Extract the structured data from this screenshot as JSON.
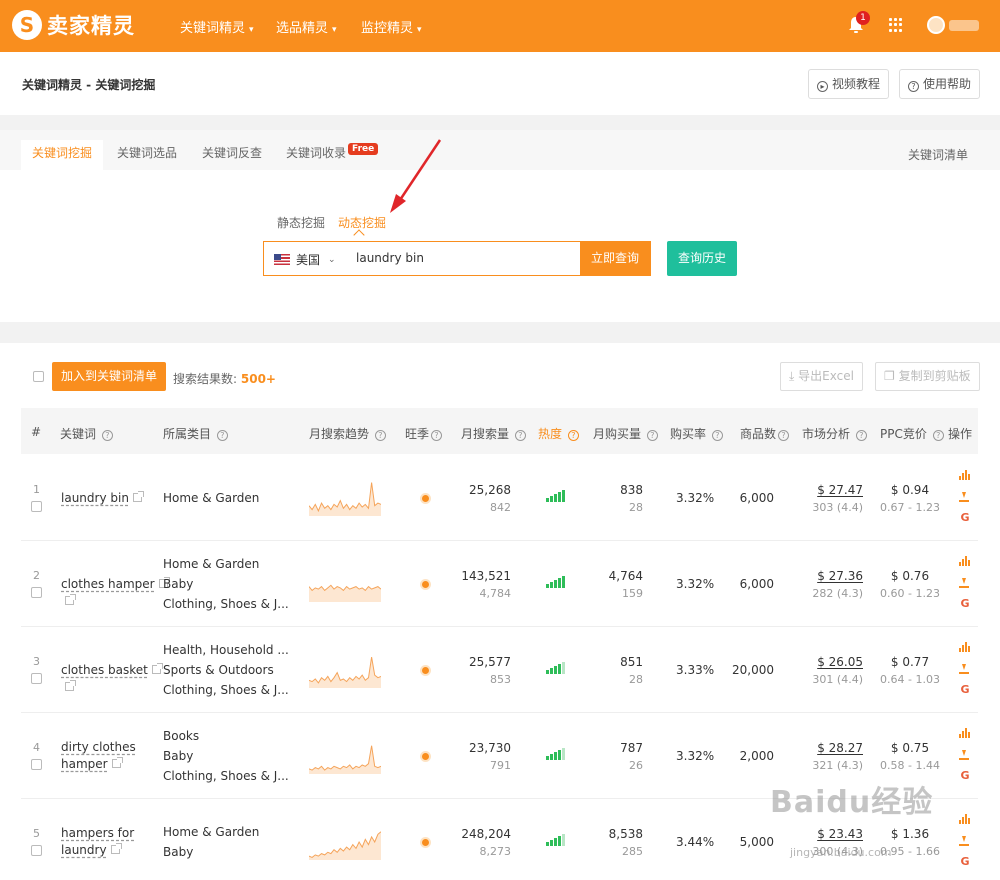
{
  "topbar": {
    "logo_glyph": "S",
    "logo_text": "卖家精灵",
    "nav": [
      {
        "label": "关键词精灵"
      },
      {
        "label": "选品精灵"
      },
      {
        "label": "监控精灵"
      }
    ],
    "notification_count": "1",
    "caret": "▾"
  },
  "header": {
    "breadcrumb": "关键词精灵 - 关键词挖掘",
    "video_btn": "视频教程",
    "help_btn": "使用帮助"
  },
  "tabs": {
    "items": [
      "关键词挖掘",
      "关键词选品",
      "关键词反查",
      "关键词收录"
    ],
    "free_badge": "Free",
    "right": "关键词清单"
  },
  "search": {
    "modes": [
      "静态挖掘",
      "动态挖掘"
    ],
    "country": "美国",
    "keyword": "laundry bin",
    "submit_label": "立即查询",
    "history_label": "查询历史"
  },
  "results": {
    "add_label": "加入到关键词清单",
    "count_label": "搜索结果数:",
    "count_value": "500+",
    "export_label": "导出Excel",
    "copy_label": "复制到剪贴板",
    "columns": {
      "index": "#",
      "keyword": "关键词",
      "category": "所属类目",
      "trend": "月搜索趋势",
      "season": "旺季",
      "searches": "月搜索量",
      "heat": "热度",
      "purchases": "月购买量",
      "rate": "购买率",
      "products": "商品数",
      "market": "市场分析",
      "ppc": "PPC竞价",
      "ops": "操作"
    },
    "rows": [
      {
        "rank": "1",
        "keyword": [
          "laundry bin"
        ],
        "categories": [
          "Home & Garden"
        ],
        "searches": "25,268",
        "searches_sub": "842",
        "heat": 5,
        "purchases": "838",
        "purchases_sub": "28",
        "rate": "3.32%",
        "products": "6,000",
        "market": "$ 27.47",
        "market_sub": "303 (4.4)",
        "ppc": "$ 0.94",
        "ppc_sub": "0.67 - 1.23"
      },
      {
        "rank": "2",
        "keyword": [
          "clothes hamper"
        ],
        "categories": [
          "Home & Garden",
          "Baby",
          "Clothing, Shoes & J..."
        ],
        "searches": "143,521",
        "searches_sub": "4,784",
        "heat": 5,
        "purchases": "4,764",
        "purchases_sub": "159",
        "rate": "3.32%",
        "products": "6,000",
        "market": "$ 27.36",
        "market_sub": "282 (4.3)",
        "ppc": "$ 0.76",
        "ppc_sub": "0.60 - 1.23"
      },
      {
        "rank": "3",
        "keyword": [
          "clothes basket"
        ],
        "categories": [
          "Health, Household ...",
          "Sports & Outdoors",
          "Clothing, Shoes & J..."
        ],
        "searches": "25,577",
        "searches_sub": "853",
        "heat": 4,
        "purchases": "851",
        "purchases_sub": "28",
        "rate": "3.33%",
        "products": "20,000",
        "market": "$ 26.05",
        "market_sub": "301 (4.4)",
        "ppc": "$ 0.77",
        "ppc_sub": "0.64 - 1.03"
      },
      {
        "rank": "4",
        "keyword": [
          "dirty clothes",
          "hamper"
        ],
        "categories": [
          "Books",
          "Baby",
          "Clothing, Shoes & J..."
        ],
        "searches": "23,730",
        "searches_sub": "791",
        "heat": 4,
        "purchases": "787",
        "purchases_sub": "26",
        "rate": "3.32%",
        "products": "2,000",
        "market": "$ 28.27",
        "market_sub": "321 (4.3)",
        "ppc": "$ 0.75",
        "ppc_sub": "0.58 - 1.44"
      },
      {
        "rank": "5",
        "keyword": [
          "hampers for",
          "laundry"
        ],
        "categories": [
          "Home & Garden",
          "Baby"
        ],
        "searches": "248,204",
        "searches_sub": "8,273",
        "heat": 4,
        "purchases": "8,538",
        "purchases_sub": "285",
        "rate": "3.44%",
        "products": "5,000",
        "market": "$ 23.43",
        "market_sub": "300 (4.3)",
        "ppc": "$ 1.36",
        "ppc_sub": "0.95 - 1.66"
      }
    ]
  },
  "watermark": {
    "text": "Baidu经验",
    "sub": "jingyan.baidu.com"
  },
  "colors": {
    "brand": "#f98e1e",
    "teal": "#1fbf9c",
    "heat": "#2ebd59"
  }
}
